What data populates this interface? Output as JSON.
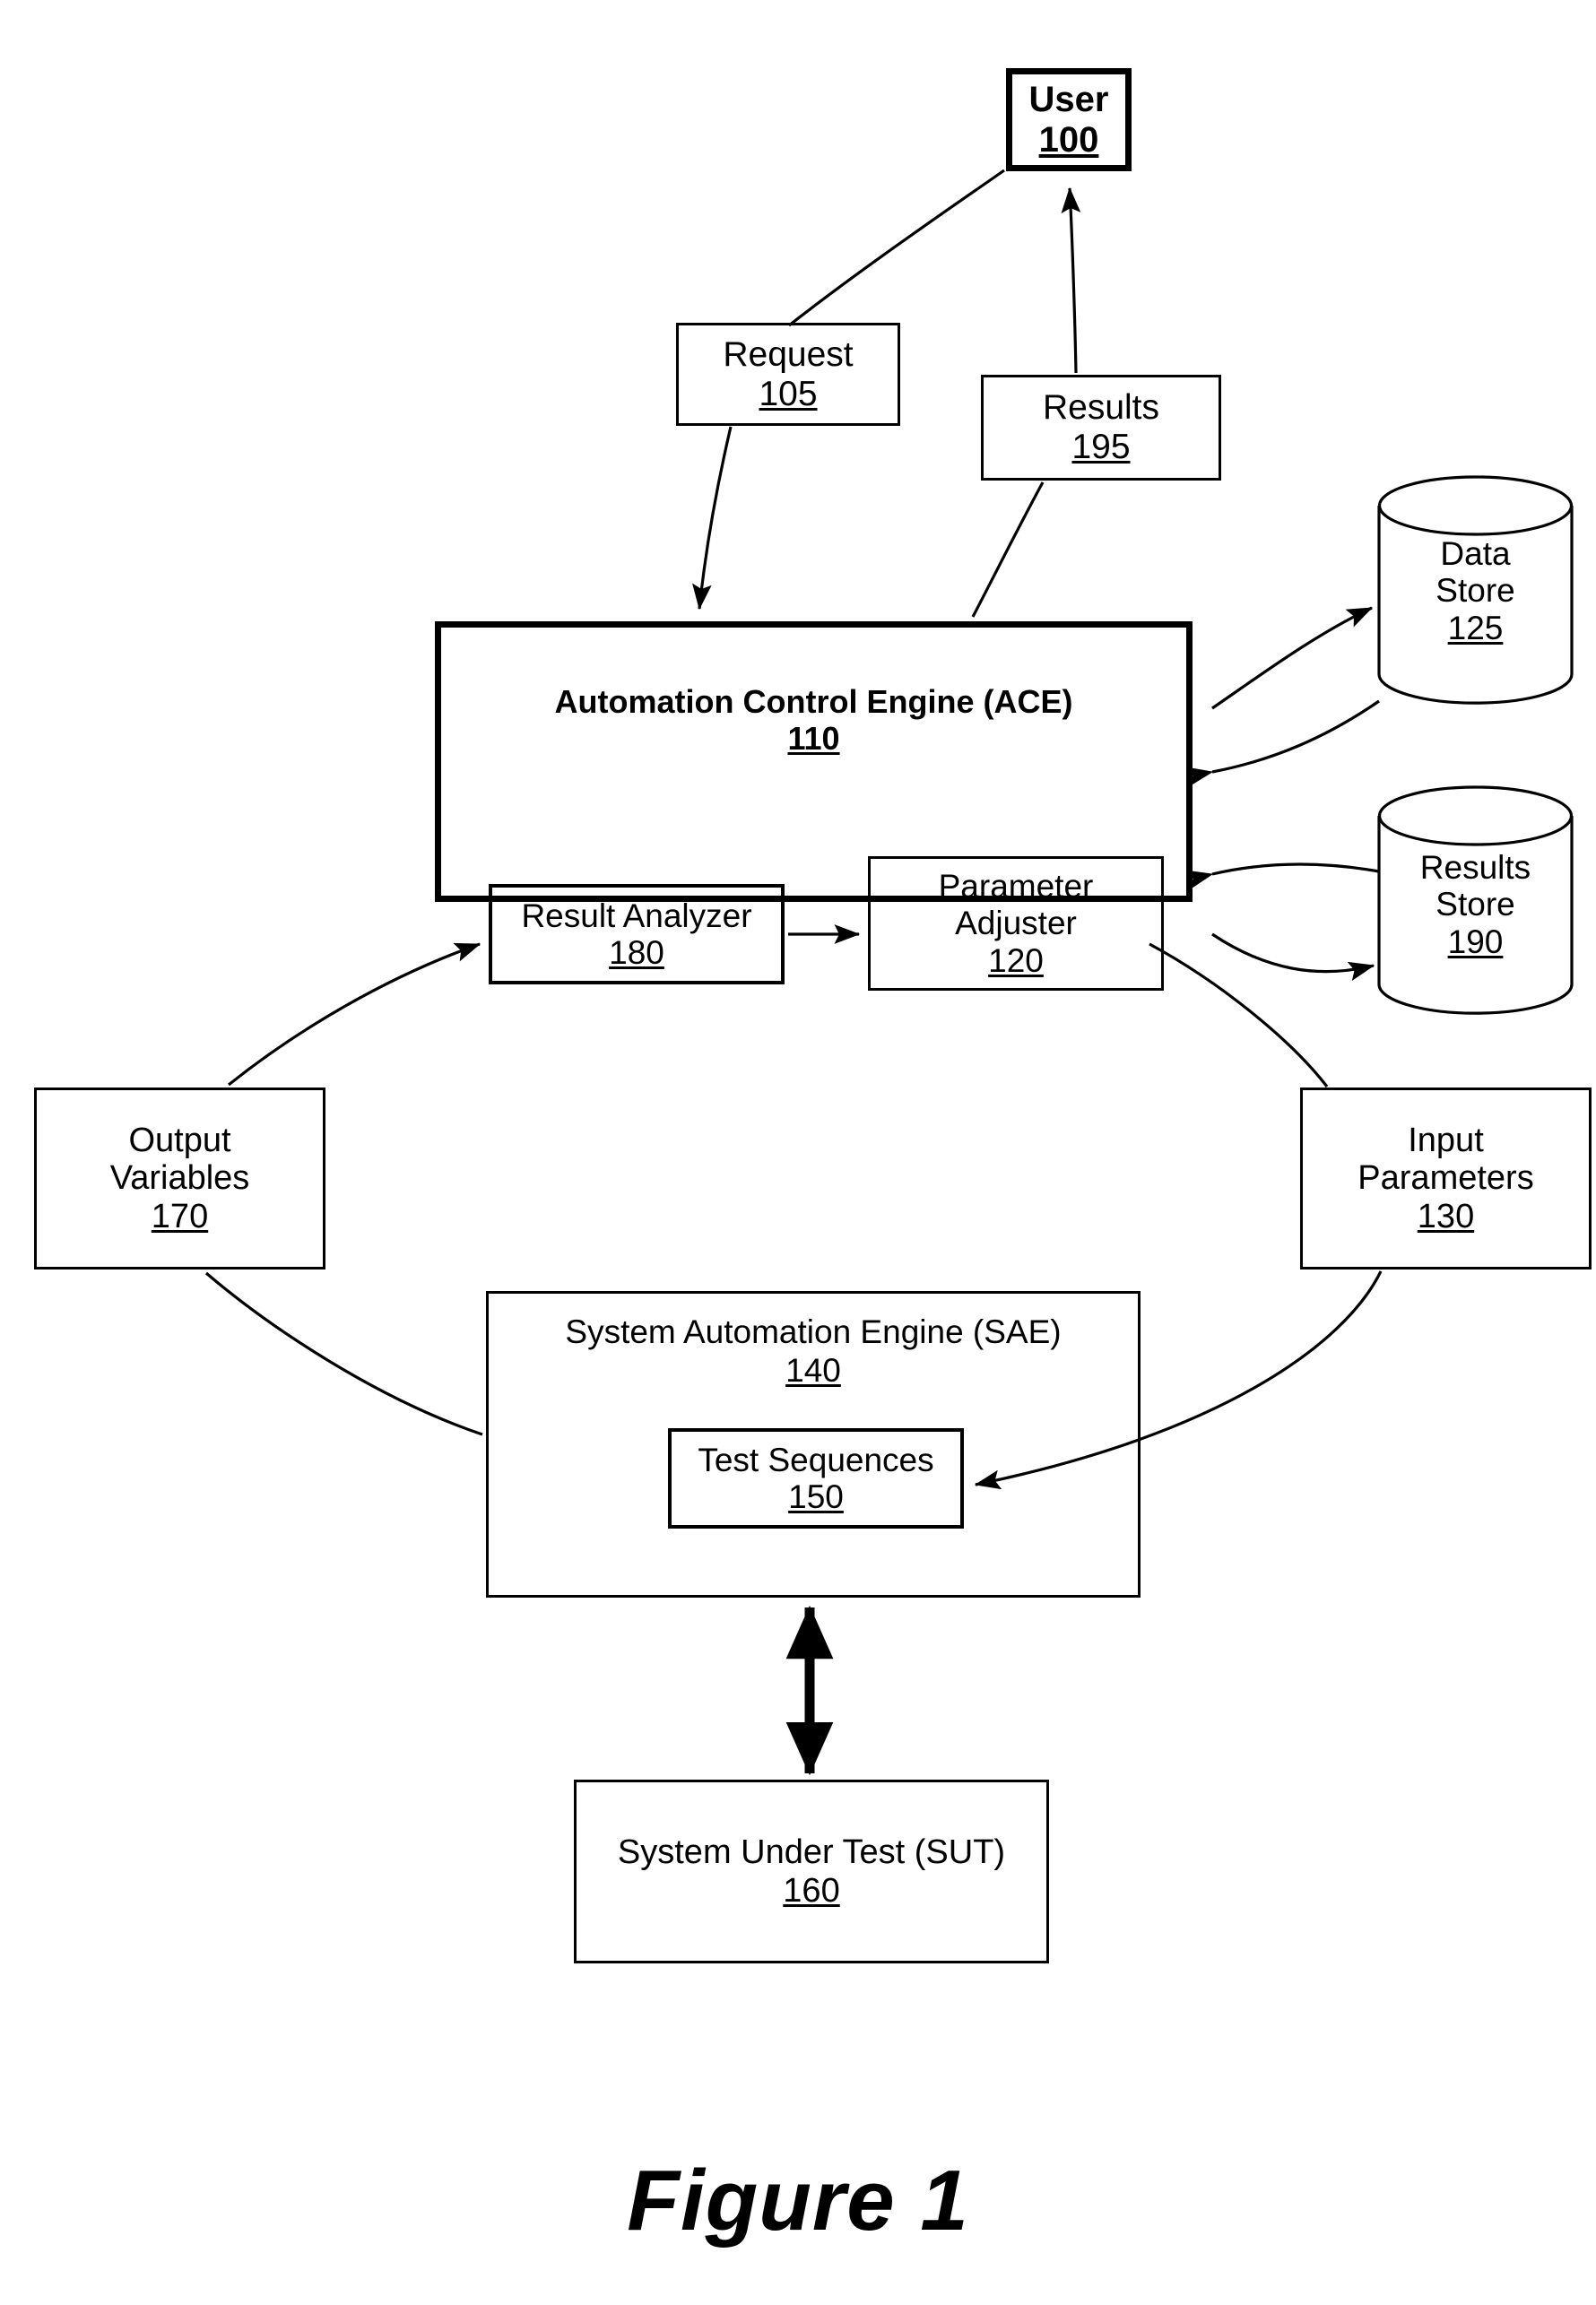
{
  "figure": {
    "caption": "Figure 1"
  },
  "nodes": {
    "user": {
      "title": "User",
      "ref": "100"
    },
    "request": {
      "title": "Request",
      "ref": "105"
    },
    "results_label": {
      "title": "Results",
      "ref": "195"
    },
    "ace": {
      "title": "Automation Control Engine (ACE)",
      "ref": "110"
    },
    "result_analyzer": {
      "title": "Result Analyzer",
      "ref": "180"
    },
    "param_adjuster": {
      "title_line1": "Parameter",
      "title_line2": "Adjuster",
      "ref": "120"
    },
    "data_store": {
      "title_line1": "Data",
      "title_line2": "Store",
      "ref": "125"
    },
    "results_store": {
      "title_line1": "Results",
      "title_line2": "Store",
      "ref": "190"
    },
    "output_vars": {
      "title_line1": "Output",
      "title_line2": "Variables",
      "ref": "170"
    },
    "input_params": {
      "title_line1": "Input",
      "title_line2": "Parameters",
      "ref": "130"
    },
    "sae": {
      "title": "System Automation Engine (SAE)",
      "ref": "140"
    },
    "test_sequences": {
      "title": "Test Sequences",
      "ref": "150"
    },
    "sut": {
      "title": "System Under Test (SUT)",
      "ref": "160"
    }
  },
  "connectors": [
    {
      "name": "user-to-request",
      "from": "user",
      "to": "request",
      "arrow": "none",
      "style": "curve"
    },
    {
      "name": "request-to-ace",
      "from": "request",
      "to": "ace",
      "arrow": "end",
      "style": "curve"
    },
    {
      "name": "ace-to-results-label",
      "from": "ace",
      "to": "results_label",
      "arrow": "none",
      "style": "curve"
    },
    {
      "name": "results-label-to-user",
      "from": "results_label",
      "to": "user",
      "arrow": "end",
      "style": "curve"
    },
    {
      "name": "ace-data-store-link",
      "from": "ace",
      "to": "data_store",
      "arrow": "both",
      "style": "curve"
    },
    {
      "name": "ace-results-store-link",
      "from": "ace",
      "to": "results_store",
      "arrow": "both",
      "style": "curve"
    },
    {
      "name": "result-analyzer-to-adjuster",
      "from": "result_analyzer",
      "to": "param_adjuster",
      "arrow": "end",
      "style": "straight"
    },
    {
      "name": "output-vars-to-analyzer",
      "from": "output_vars",
      "to": "result_analyzer",
      "arrow": "end",
      "style": "curve"
    },
    {
      "name": "adjuster-to-input-params",
      "from": "param_adjuster",
      "to": "input_params",
      "arrow": "none",
      "style": "curve"
    },
    {
      "name": "input-params-to-test-seq",
      "from": "input_params",
      "to": "test_sequences",
      "arrow": "end",
      "style": "curve"
    },
    {
      "name": "sae-to-output-vars",
      "from": "sae",
      "to": "output_vars",
      "arrow": "none",
      "style": "curve"
    },
    {
      "name": "sae-sut-link",
      "from": "sae",
      "to": "sut",
      "arrow": "both",
      "style": "straight-thick"
    }
  ],
  "colors": {
    "stroke": "#000000",
    "background": "#ffffff"
  }
}
